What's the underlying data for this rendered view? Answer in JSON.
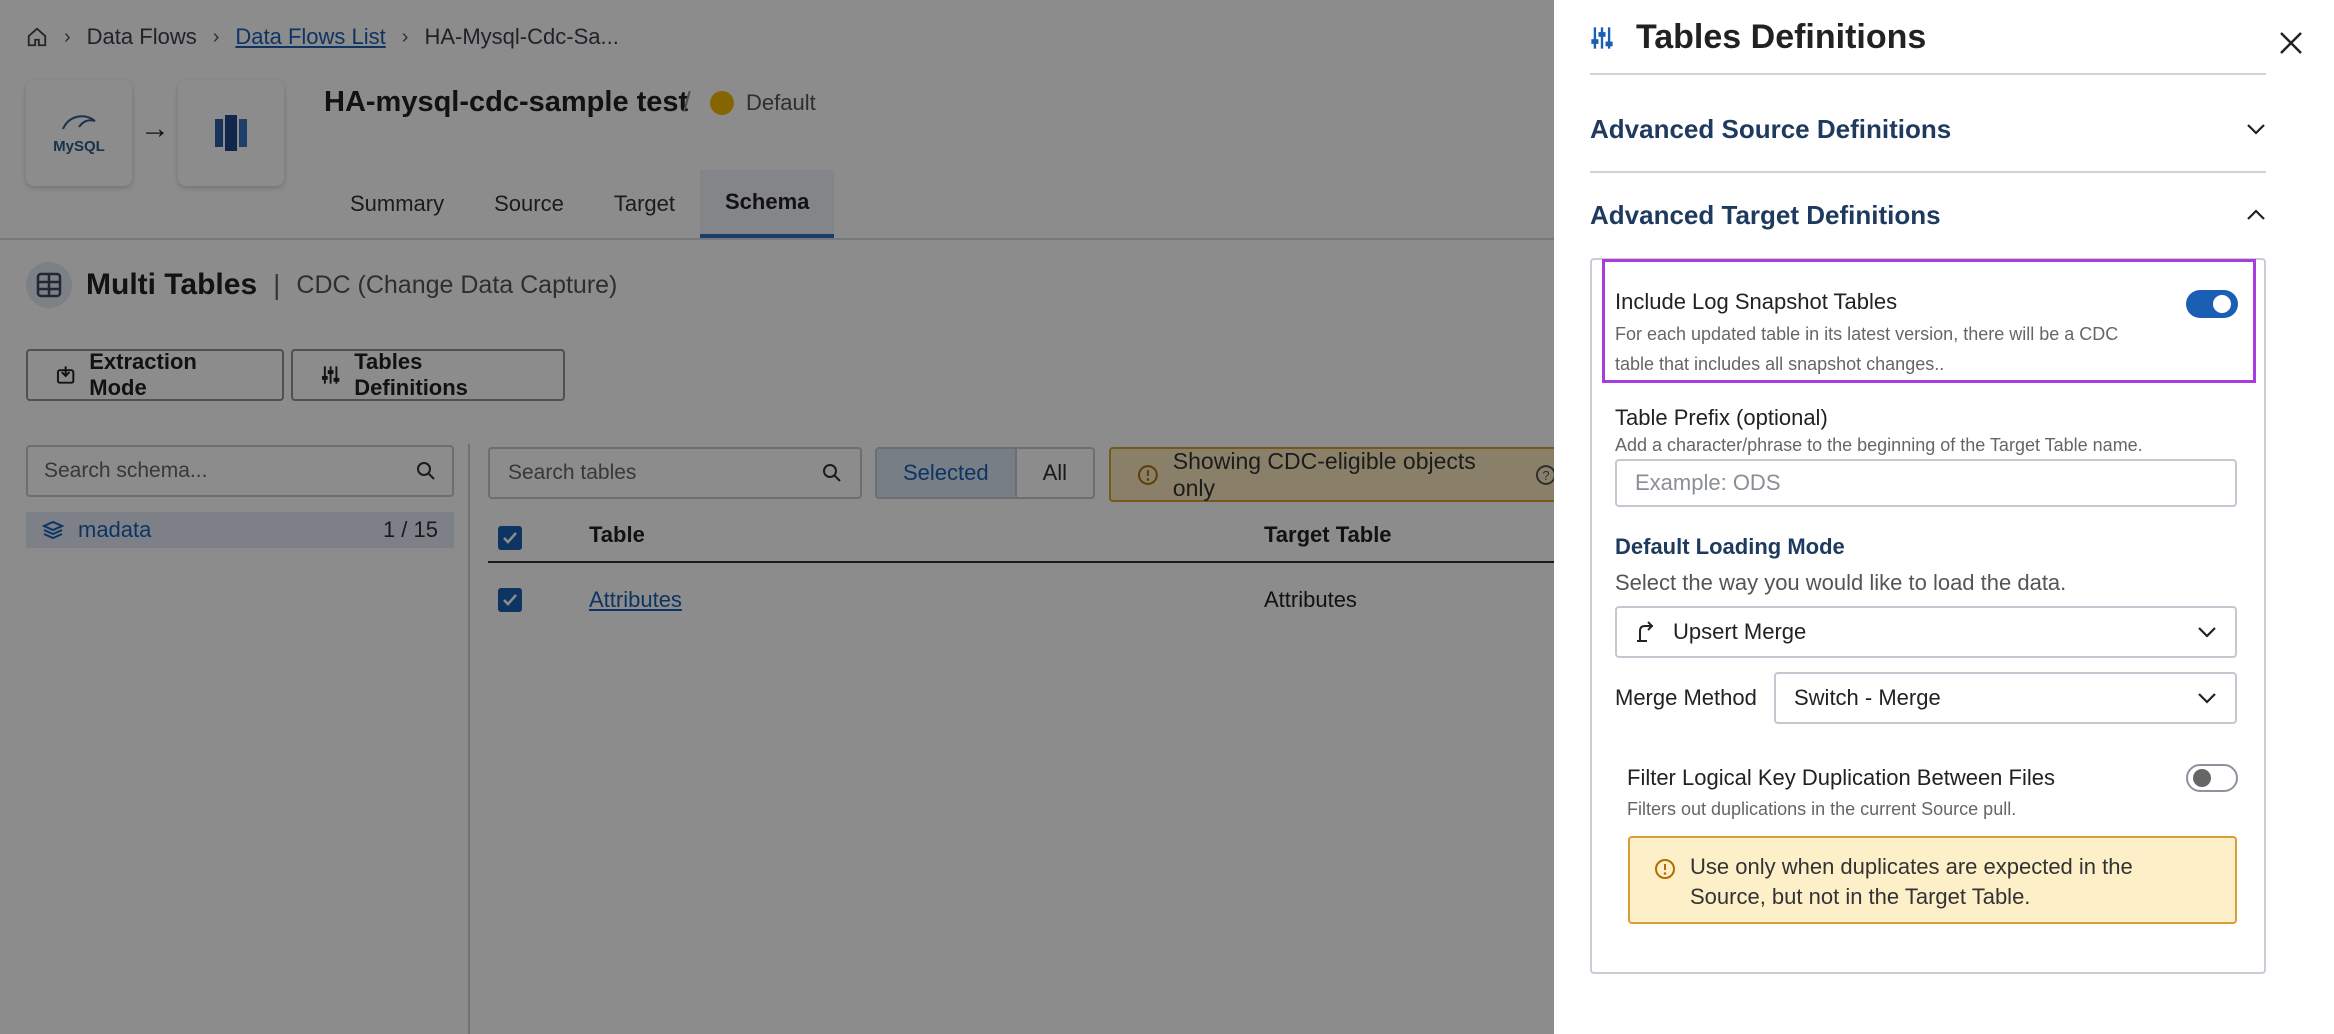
{
  "breadcrumb": {
    "items": [
      "Data Flows",
      "Data Flows List",
      "HA-Mysql-Cdc-Sa..."
    ]
  },
  "flow": {
    "source_logo_text": "MySQL",
    "title": "HA-mysql-cdc-sample test",
    "separator": "/",
    "environment": "Default"
  },
  "tabs": [
    "Summary",
    "Source",
    "Target",
    "Schema"
  ],
  "main": {
    "heading": "Multi Tables",
    "pipe": "|",
    "subheading": "CDC (Change Data Capture)",
    "extraction_button": "Extraction Mode",
    "definitions_button": "Tables Definitions",
    "schema_search_placeholder": "Search schema...",
    "schema": {
      "name": "madata",
      "count": "1 / 15"
    },
    "tables_search_placeholder": "Search tables",
    "filter": {
      "selected": "Selected",
      "all": "All"
    },
    "cdc_banner": "Showing CDC-eligible objects only",
    "columns": {
      "table": "Table",
      "target": "Target Table"
    },
    "rows": [
      {
        "table": "Attributes",
        "target": "Attributes"
      }
    ]
  },
  "drawer": {
    "title": "Tables Definitions",
    "advanced_source": "Advanced Source Definitions",
    "advanced_target": "Advanced Target Definitions",
    "log_snapshot": {
      "title": "Include Log Snapshot Tables",
      "desc_line1": "For each updated table in its latest version, there will be a CDC",
      "desc_line2": "table that includes all snapshot changes..",
      "enabled": true
    },
    "table_prefix": {
      "title": "Table Prefix (optional)",
      "desc": "Add a character/phrase to the beginning of the Target Table name.",
      "placeholder": "Example: ODS",
      "value": ""
    },
    "loading_mode": {
      "title": "Default Loading Mode",
      "desc": "Select the way you would like to load the data.",
      "value": "Upsert Merge"
    },
    "merge_method": {
      "label": "Merge Method",
      "value": "Switch - Merge"
    },
    "filter_dup": {
      "title": "Filter Logical Key Duplication Between Files",
      "desc": "Filters out duplications in the current Source pull.",
      "enabled": false
    },
    "warning_line1": "Use only when duplicates are expected in the",
    "warning_line2": "Source, but not in the Target Table."
  },
  "colors": {
    "accent": "#1b5fb5",
    "highlight": "#a93ce0",
    "warning_bg": "#fdefc8",
    "warning_border": "#d6a033"
  }
}
